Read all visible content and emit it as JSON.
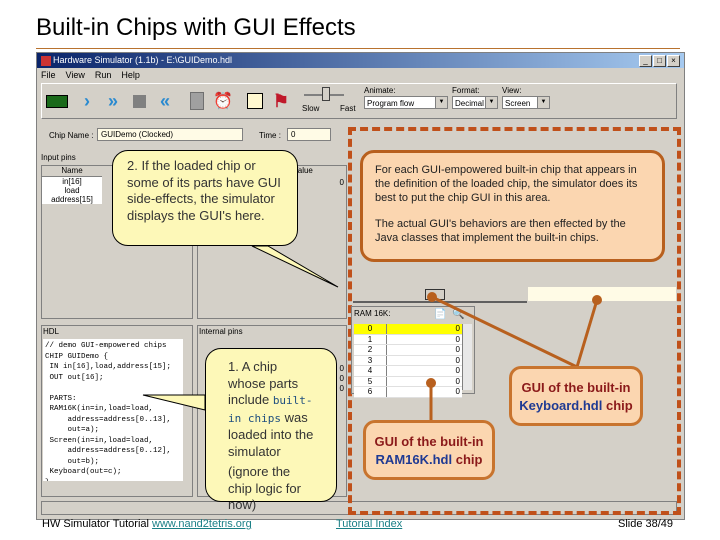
{
  "slide": {
    "title": "Built-in Chips with GUI Effects",
    "footer": {
      "left_text": "HW Simulator Tutorial",
      "link": "www.nand2tetris.org",
      "index_link": "Tutorial Index",
      "slide_number": "Slide 38/49"
    }
  },
  "window": {
    "title": "Hardware Simulator (1.1b) - E:\\GUIDemo.hdl",
    "controls": [
      "_",
      "□",
      "×"
    ],
    "menu": [
      "File",
      "View",
      "Run",
      "Help"
    ],
    "toolbar": {
      "icons": [
        "chip-load-icon",
        "single-step-icon",
        "run-icon",
        "stop-icon",
        "reset-icon",
        "calculator-icon",
        "clock-icon",
        "script-icon",
        "breakpoint-flag-icon"
      ],
      "slow_label": "Slow",
      "fast_label": "Fast",
      "speed_percent": 60,
      "animate_label": "Animate:",
      "animate_value": "Program flow",
      "format_label": "Format:",
      "format_value": "Decimal",
      "view_label": "View:",
      "view_value": "Screen"
    },
    "chip_name_label": "Chip Name :",
    "chip_name_value": "GUIDemo (Clocked)",
    "time_label": "Time :",
    "time_value": "0",
    "input_pins": {
      "label": "Input pins",
      "col_name": "Name",
      "col_value": "Value",
      "rows": [
        {
          "name": "in[16]",
          "value": "0"
        },
        {
          "name": "load",
          "value": ""
        },
        {
          "name": "address[15]",
          "value": ""
        }
      ]
    },
    "hdl": {
      "label": "HDL",
      "code": "// demo GUI-empowered chips\nCHIP GUIDemo {\n IN in[16],load,address[15];\n OUT out[16];\n\n PARTS:\n RAM16K(in=in,load=load,\n     address=address[0..13],\n     out=a);\n Screen(in=in,load=load,\n     address=address[0..12],\n     out=b);\n Keyboard(out=c);\n}"
    },
    "internal_pins": {
      "label": "Internal pins",
      "values": [
        "0",
        "0",
        "0"
      ]
    },
    "ram": {
      "title": "RAM 16K:",
      "rows": [
        {
          "addr": "0",
          "value": "0",
          "highlight": true
        },
        {
          "addr": "1",
          "value": "0"
        },
        {
          "addr": "2",
          "value": "0"
        },
        {
          "addr": "3",
          "value": "0"
        },
        {
          "addr": "4",
          "value": "0"
        },
        {
          "addr": "5",
          "value": "0"
        },
        {
          "addr": "6",
          "value": "0"
        }
      ]
    }
  },
  "callouts": {
    "gui_side_effects": "2. If the loaded chip or some of its parts have GUI side-effects, the simulator displays the GUI's here.",
    "chip_loaded_1": "1. A chip whose parts include ",
    "chip_loaded_link": "built-in chips",
    "chip_loaded_2": " was loaded into the simulator",
    "chip_loaded_note": "(ignore the chip logic for now)",
    "gui_area_note_1": "For each GUI-empowered built-in chip that appears in the definition of the loaded chip, the simulator does its best to put the chip GUI in this area.",
    "gui_area_note_2": "The actual GUI's behaviors are then effected by the Java classes that implement the built-in chips.",
    "keyboard_label_1": "GUI of the built-in",
    "keyboard_label_2": "Keyboard.hdl",
    "keyboard_label_3": " chip",
    "ram_label_1": "GUI of the built-in",
    "ram_label_2": "RAM16K.hdl",
    "ram_label_3": " chip"
  }
}
